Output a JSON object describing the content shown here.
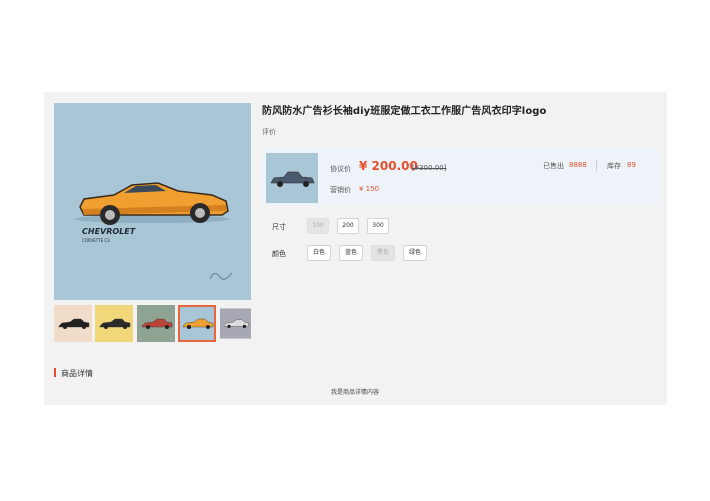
{
  "product": {
    "title": "防风防水广告衫长袖diy班服定做工衣工作服广告风衣印字logo",
    "rating_label": "评价",
    "main_image": {
      "brand_text": "CHEVROLET",
      "model_text": "CORVETTE C3"
    }
  },
  "thumbnails": [
    {
      "name": "thumb-peach",
      "bg": "#f0dcc8",
      "car": "#222222"
    },
    {
      "name": "thumb-yellow",
      "bg": "#f2d67a",
      "car": "#2b2b2b"
    },
    {
      "name": "thumb-sage",
      "bg": "#8fa393",
      "car": "#b9453a"
    },
    {
      "name": "thumb-orange",
      "bg": "#a9c6d6",
      "car": "#f0a030"
    },
    {
      "name": "thumb-gray",
      "bg": "#a8a8b4",
      "car": "#dddddd"
    }
  ],
  "price_box": {
    "negotiated_label": "协议价",
    "negotiated_price": "¥ 200.00",
    "original_price": "[¥300.00]",
    "sale_label": "营销价",
    "sale_price": "¥ 150",
    "sold_label": "已售出",
    "sold_value": "8888",
    "stock_label": "库存",
    "stock_value": "89"
  },
  "options": {
    "size_label": "尺寸",
    "sizes": [
      {
        "label": "100",
        "disabled": true
      },
      {
        "label": "200",
        "disabled": false
      },
      {
        "label": "300",
        "disabled": false
      }
    ],
    "color_label": "颜色",
    "colors": [
      {
        "label": "白色",
        "disabled": false
      },
      {
        "label": "蓝色",
        "disabled": false
      },
      {
        "label": "黑色",
        "disabled": true
      },
      {
        "label": "绿色",
        "disabled": false
      }
    ]
  },
  "detail": {
    "section_title": "商品详情",
    "content": "我是商品详情内容"
  },
  "colors": {
    "accent": "#e4502a",
    "price_box_bg": "#eef3fa",
    "panel_bg": "#f2f2f2",
    "main_image_bg": "#a9c6d6",
    "car_body": "#f0a030"
  }
}
